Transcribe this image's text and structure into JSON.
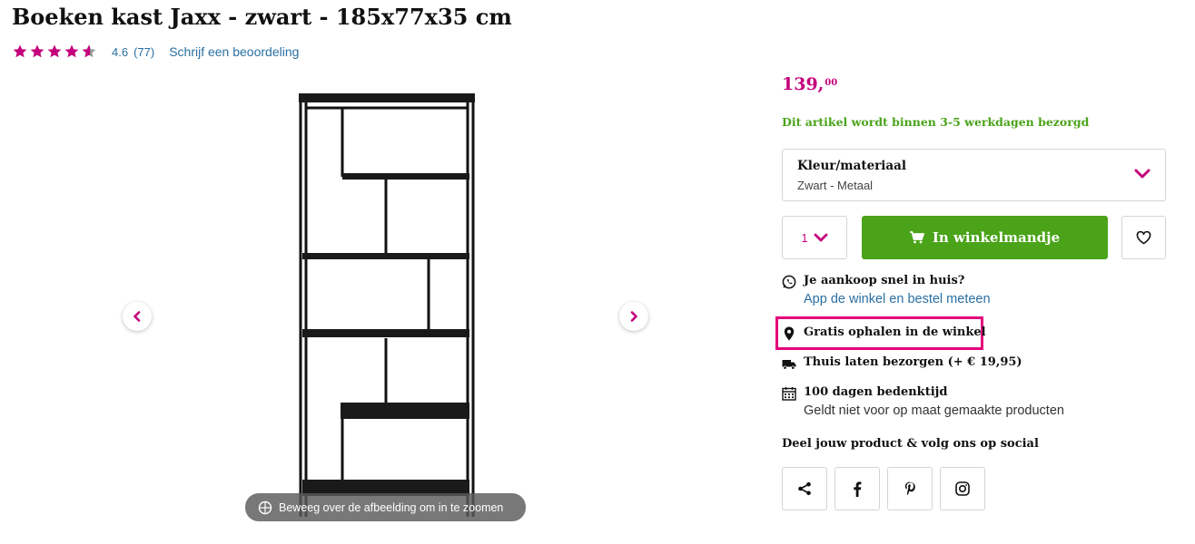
{
  "product": {
    "title": "Boeken kast Jaxx - zwart - 185x77x35 cm",
    "rating_value": "4.6",
    "rating_count": "(77)",
    "rating_stars": 4.6,
    "review_link": "Schrijf een beoordeling"
  },
  "gallery": {
    "zoom_hint": "Beweeg over de afbeelding om in te zoomen"
  },
  "pricing": {
    "price_main": "139,",
    "price_cents": "00",
    "delivery_note": "Dit artikel wordt binnen 3-5 werkdagen bezorgd"
  },
  "variant": {
    "label": "Kleur/materiaal",
    "value": "Zwart - Metaal"
  },
  "purchase": {
    "quantity": "1",
    "cart_label": "In winkelmandje"
  },
  "info": {
    "whatsapp_title": "Je aankoop snel in huis?",
    "whatsapp_link": "App de winkel en bestel meteen",
    "pickup": "Gratis ophalen in de winkel",
    "home_delivery": "Thuis laten bezorgen (+ € 19,95)",
    "return_title": "100 dagen bedenktijd",
    "return_note": "Geldt niet voor op maat gemaakte producten"
  },
  "share": {
    "title": "Deel jouw product & volg ons op social"
  },
  "colors": {
    "brand_pink": "#c4007c",
    "accent_green": "#4aa319",
    "link_blue": "#2a6fa1",
    "highlight": "#e4007c"
  }
}
